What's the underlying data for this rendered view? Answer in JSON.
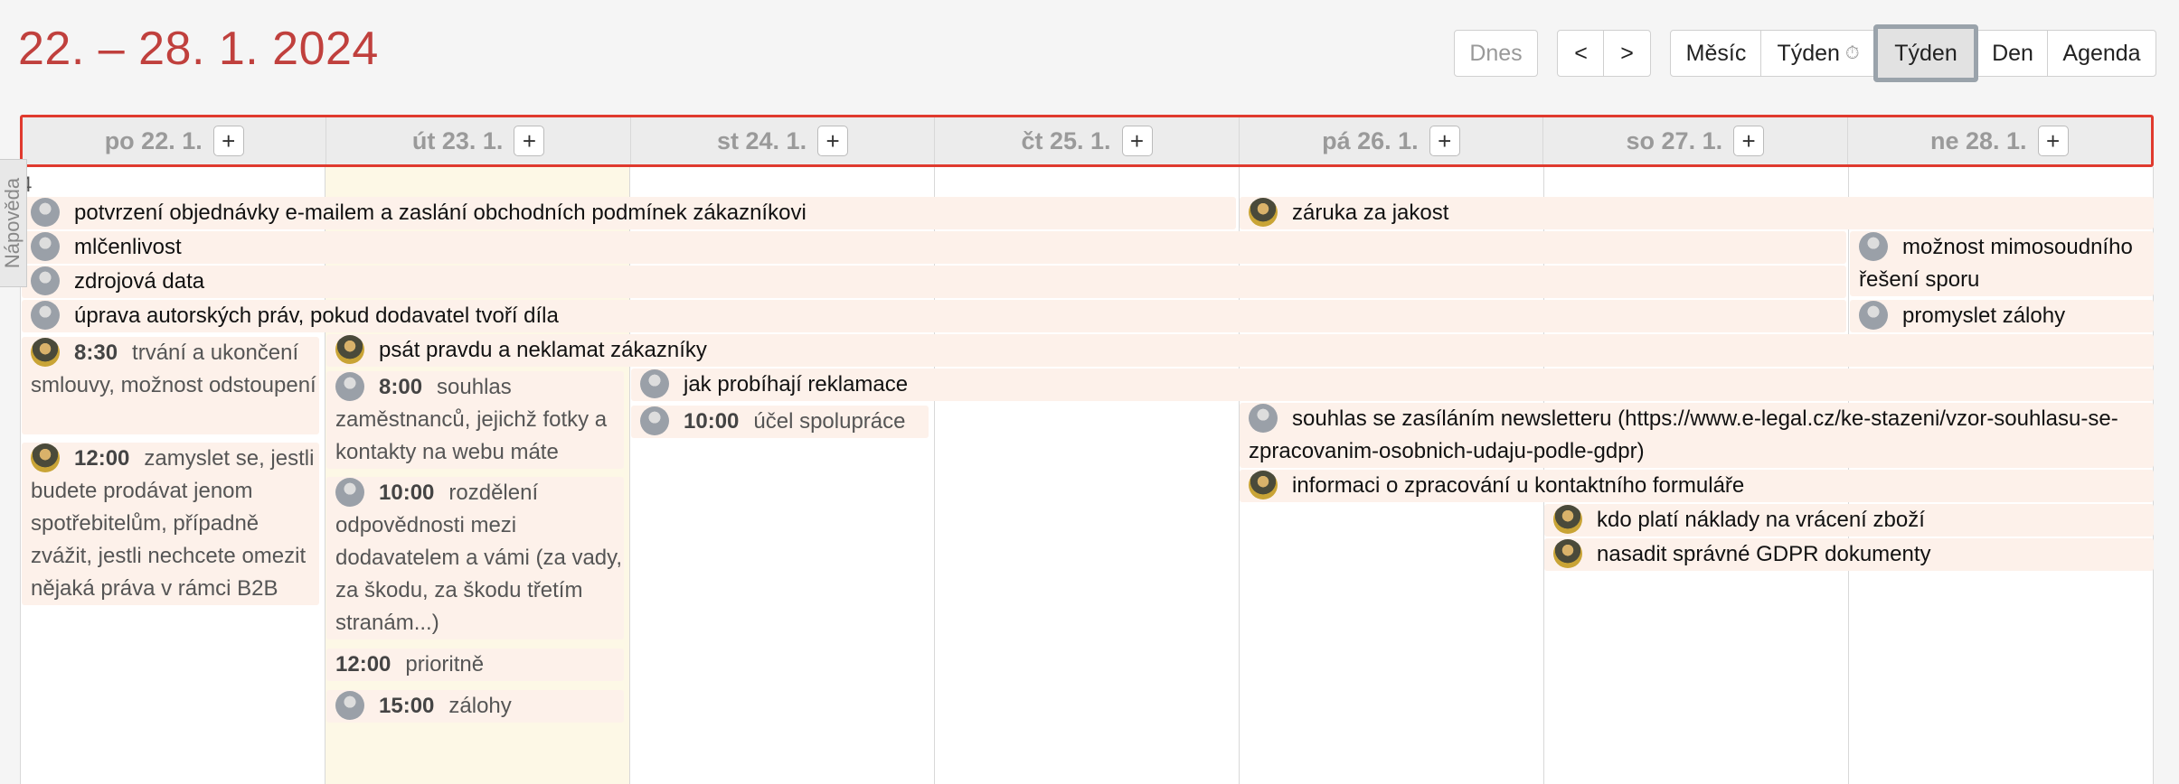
{
  "title": "22. – 28. 1. 2024",
  "toolbar": {
    "today": "Dnes",
    "prev": "<",
    "next": ">",
    "views": {
      "month": "Měsíc",
      "week_timed": "Týden",
      "week_timed_icon": "⏱",
      "week": "Týden",
      "day": "Den",
      "agenda": "Agenda"
    },
    "active_view": "Týden"
  },
  "help_tab": "Nápověda",
  "week_number": "4",
  "days": [
    {
      "label": "po 22. 1.",
      "add": "+"
    },
    {
      "label": "út 23. 1.",
      "add": "+"
    },
    {
      "label": "st 24. 1.",
      "add": "+"
    },
    {
      "label": "čt 25. 1.",
      "add": "+"
    },
    {
      "label": "pá 26. 1.",
      "add": "+"
    },
    {
      "label": "so 27. 1.",
      "add": "+"
    },
    {
      "label": "ne 28. 1.",
      "add": "+"
    }
  ],
  "today_index": 1,
  "events": {
    "e1": {
      "text": "potvrzení objednávky e-mailem a zaslání obchodních podmínek zákazníkovi"
    },
    "e2": {
      "text": "záruka za jakost"
    },
    "e3": {
      "text": "mlčenlivost"
    },
    "e4": {
      "text": "možnost mimosoudního řešení sporu"
    },
    "e5": {
      "text": "zdrojová data"
    },
    "e6": {
      "text": "úprava autorských práv, pokud dodavatel tvoří díla"
    },
    "e7": {
      "text": "promyslet zálohy"
    },
    "e8": {
      "time": "8:30",
      "text": "trvání a ukončení smlouvy, možnost odstoupení"
    },
    "e9": {
      "text": "psát pravdu a neklamat zákazníky"
    },
    "e10": {
      "time": "8:00",
      "text": "souhlas zaměstnanců, jejichž fotky a kontakty na webu máte"
    },
    "e11": {
      "text": "jak probíhají reklamace"
    },
    "e12": {
      "time": "10:00",
      "text": "účel spolupráce"
    },
    "e13": {
      "text": "souhlas se zasíláním newsletteru (https://www.e-legal.cz/ke-stazeni/vzor-souhlasu-se-zpracovanim-osobnich-udaju-podle-gdpr)"
    },
    "e14": {
      "time": "12:00",
      "text": "zamyslet se, jestli budete prodávat jenom spotřebitelům, případně zvážit, jestli nechcete omezit nějaká práva v rámci B2B"
    },
    "e15": {
      "time": "10:00",
      "text": "rozdělení odpovědnosti mezi dodavatelem a vámi (za vady, za škodu, za škodu třetím stranám...)"
    },
    "e16": {
      "text": "informaci o zpracování u kontaktního formuláře"
    },
    "e17": {
      "text": "kdo platí náklady na vrácení zboží"
    },
    "e18": {
      "text": "nasadit správné GDPR dokumenty"
    },
    "e19": {
      "time": "12:00",
      "text": "prioritně"
    },
    "e20": {
      "time": "15:00",
      "text": "zálohy"
    }
  },
  "colors": {
    "title": "#c0403d",
    "event_bg": "#fdf1ea",
    "today_bg": "#fdf8e6",
    "header_outline": "#e03a2e"
  }
}
